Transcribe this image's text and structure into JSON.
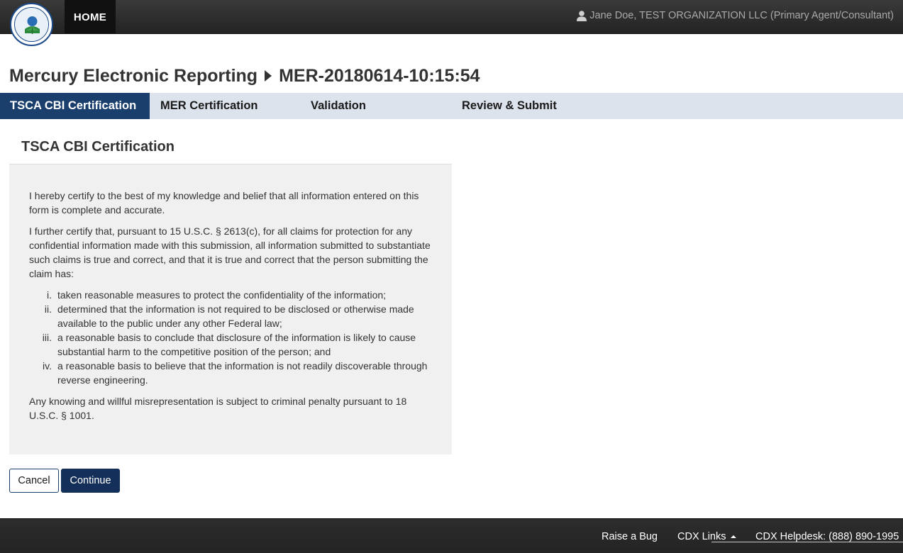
{
  "header": {
    "logo_alt": "United States Environmental Protection Agency",
    "home_label": "HOME",
    "user_text": "Jane Doe, TEST ORGANIZATION LLC (Primary Agent/Consultant)"
  },
  "page": {
    "title_main": "Mercury Electronic Reporting",
    "title_sub": "MER-20180614-10:15:54"
  },
  "steps": [
    {
      "label": "TSCA CBI Certification",
      "active": true
    },
    {
      "label": "MER Certification",
      "active": false
    },
    {
      "label": "Validation",
      "active": false
    },
    {
      "label": "Review & Submit",
      "active": false
    }
  ],
  "section": {
    "title": "TSCA CBI Certification",
    "para1": "I hereby certify to the best of my knowledge and belief that all information entered on this form is complete and accurate.",
    "para2": "I further certify that, pursuant to 15 U.S.C. § 2613(c), for all claims for protection for any confidential information made with this submission, all information submitted to substantiate such claims is true and correct, and that it is true and correct that the person submitting the claim has:",
    "items": [
      {
        "num": "i.",
        "text": "taken reasonable measures to protect the confidentiality of the information;"
      },
      {
        "num": "ii.",
        "text": "determined that the information is not required to be disclosed or otherwise made available to the public under any other Federal law;"
      },
      {
        "num": "iii.",
        "text": "a reasonable basis to conclude that disclosure of the information is likely to cause substantial harm to the competitive position of the person; and"
      },
      {
        "num": "iv.",
        "text": "a reasonable basis to believe that the information is not readily discoverable through reverse engineering."
      }
    ],
    "para3": "Any knowing and willful misrepresentation is subject to criminal penalty pursuant to 18 U.S.C. § 1001."
  },
  "buttons": {
    "cancel": "Cancel",
    "continue": "Continue"
  },
  "footer": {
    "raise_bug": "Raise a Bug",
    "cdx_links": "CDX Links",
    "helpdesk": "CDX Helpdesk: (888) 890-1995"
  },
  "colors": {
    "nav_active": "#1a3f6d",
    "nav_bg": "#dde3ec",
    "header_bg": "#2b2b2b",
    "box_bg": "#f0f0f0"
  }
}
